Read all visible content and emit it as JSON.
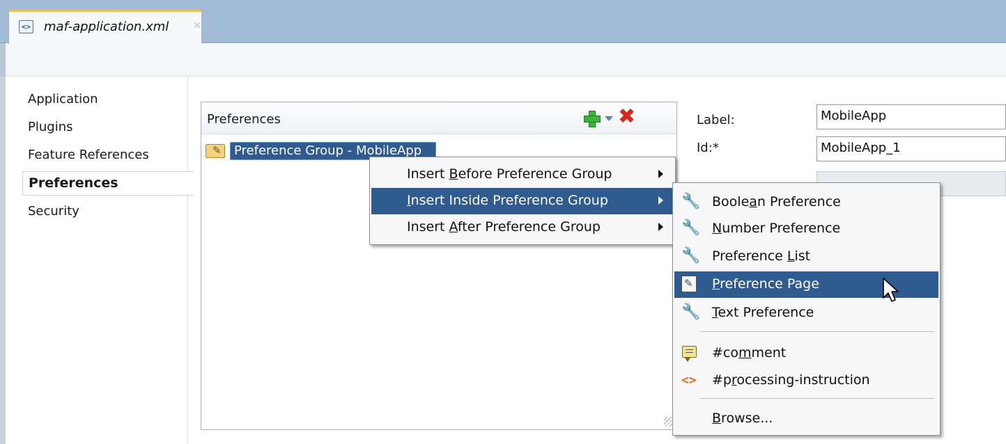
{
  "tab": {
    "title": "maf-application.xml",
    "close": "×"
  },
  "nav": {
    "items": [
      "Application",
      "Plugins",
      "Feature References",
      "Preferences",
      "Security"
    ],
    "selected": "Preferences"
  },
  "panel": {
    "title": "Preferences",
    "tree_item": "Preference Group - MobileApp"
  },
  "form": {
    "label_label": "Label:",
    "label_value": "MobileApp",
    "id_label": "Id:*",
    "id_value": "MobileApp_1"
  },
  "context_menu": {
    "items": [
      {
        "pre": "Insert ",
        "key": "B",
        "post": "efore Preference Group"
      },
      {
        "pre": "",
        "key": "I",
        "post": "nsert Inside Preference Group"
      },
      {
        "pre": "Insert ",
        "key": "A",
        "post": "fter Preference Group"
      }
    ],
    "highlighted_index": 1
  },
  "submenu": {
    "items": [
      {
        "pre": "Boole",
        "key": "a",
        "post": "n Preference",
        "icon": "wrench-icon"
      },
      {
        "pre": "",
        "key": "N",
        "post": "umber Preference",
        "icon": "wrench-icon"
      },
      {
        "pre": "Preference ",
        "key": "L",
        "post": "ist",
        "icon": "wrench-icon"
      },
      {
        "pre": "",
        "key": "P",
        "post": "reference Page",
        "icon": "page-icon"
      },
      {
        "pre": "",
        "key": "T",
        "post": "ext Preference",
        "icon": "wrench-icon"
      },
      {
        "pre": "#co",
        "key": "m",
        "post": "ment",
        "icon": "comment-icon"
      },
      {
        "pre": "#p",
        "key": "r",
        "post": "ocessing-instruction",
        "icon": "processing-instruction-icon"
      },
      {
        "pre": "",
        "key": "B",
        "post": "rowse...",
        "icon": ""
      }
    ],
    "highlighted_index": 3
  },
  "colors": {
    "tabstrip": "#a3bcd6",
    "selection": "#2f5b8f",
    "accent": "#f0c05a",
    "delete": "#d9261c",
    "add": "#3bb43b"
  }
}
